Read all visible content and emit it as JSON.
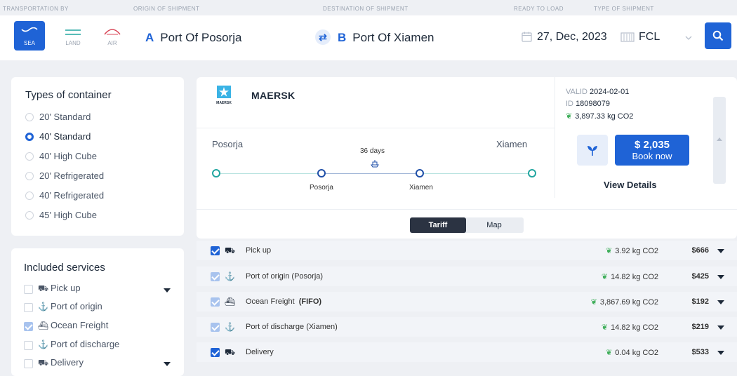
{
  "header_labels": {
    "transportation": "TRANSPORTATION BY",
    "origin": "ORIGIN OF SHIPMENT",
    "destination": "DESTINATION OF SHIPMENT",
    "ready": "READY TO LOAD",
    "type": "TYPE OF SHIPMENT"
  },
  "modes": [
    {
      "label": "SEA",
      "active": true
    },
    {
      "label": "LAND",
      "active": false
    },
    {
      "label": "AIR",
      "active": false
    }
  ],
  "origin": {
    "letter": "A",
    "value": "Port Of Posorja"
  },
  "destination": {
    "letter": "B",
    "value": "Port Of Xiamen"
  },
  "swap_icon": "⇄",
  "ready_date": "27, Dec, 2023",
  "shipment_type": "FCL",
  "colors": {
    "accent": "#1f63d6",
    "leaf": "#3fae5a",
    "route_teal": "#22a6a0"
  },
  "container_types": {
    "title": "Types of container",
    "options": [
      {
        "label": "20' Standard",
        "selected": false
      },
      {
        "label": "40' Standard",
        "selected": true
      },
      {
        "label": "40' High Cube",
        "selected": false
      },
      {
        "label": "20' Refrigerated",
        "selected": false
      },
      {
        "label": "40' Refrigerated",
        "selected": false
      },
      {
        "label": "45' High Cube",
        "selected": false
      }
    ]
  },
  "included_services": {
    "title": "Included services",
    "items": [
      {
        "label": "Pick up",
        "icon": "truck-icon",
        "checked": false
      },
      {
        "label": "Port of origin",
        "icon": "anchor-icon",
        "checked": false
      },
      {
        "label": "Ocean Freight",
        "icon": "ship-icon",
        "checked": true
      },
      {
        "label": "Port of discharge",
        "icon": "anchor-icon",
        "checked": false
      },
      {
        "label": "Delivery",
        "icon": "truck-icon",
        "checked": false
      }
    ]
  },
  "result": {
    "carrier": "MAERSK",
    "logo_text": "MAERSK",
    "route": {
      "from": "Posorja",
      "to": "Xiamen",
      "duration": "36 days",
      "leg_from": "Posorja",
      "leg_to": "Xiamen"
    },
    "valid_label": "VALID",
    "valid_date": "2024-02-01",
    "id_label": "ID",
    "id_value": "18098079",
    "co2_total": "3,897.33 kg CO2",
    "price": "$ 2,035",
    "book_label": "Book now",
    "view_details": "View Details"
  },
  "tabs": {
    "tariff": "Tariff",
    "map": "Map"
  },
  "tariff_rows": [
    {
      "name": "Pick up",
      "bold": "",
      "icon": "truck-icon",
      "checked": true,
      "co2": "3.92 kg CO2",
      "price": "$666"
    },
    {
      "name": "Port of origin (Posorja)",
      "bold": "",
      "icon": "anchor-icon",
      "checked": true,
      "co2": "14.82 kg CO2",
      "price": "$425"
    },
    {
      "name": "Ocean Freight",
      "bold": "(FIFO)",
      "icon": "ship-icon",
      "checked": true,
      "co2": "3,867.69 kg CO2",
      "price": "$192"
    },
    {
      "name": "Port of discharge (Xiamen)",
      "bold": "",
      "icon": "anchor-icon",
      "checked": true,
      "co2": "14.82 kg CO2",
      "price": "$219"
    },
    {
      "name": "Delivery",
      "bold": "",
      "icon": "truck-icon",
      "checked": true,
      "co2": "0.04 kg CO2",
      "price": "$533"
    }
  ]
}
